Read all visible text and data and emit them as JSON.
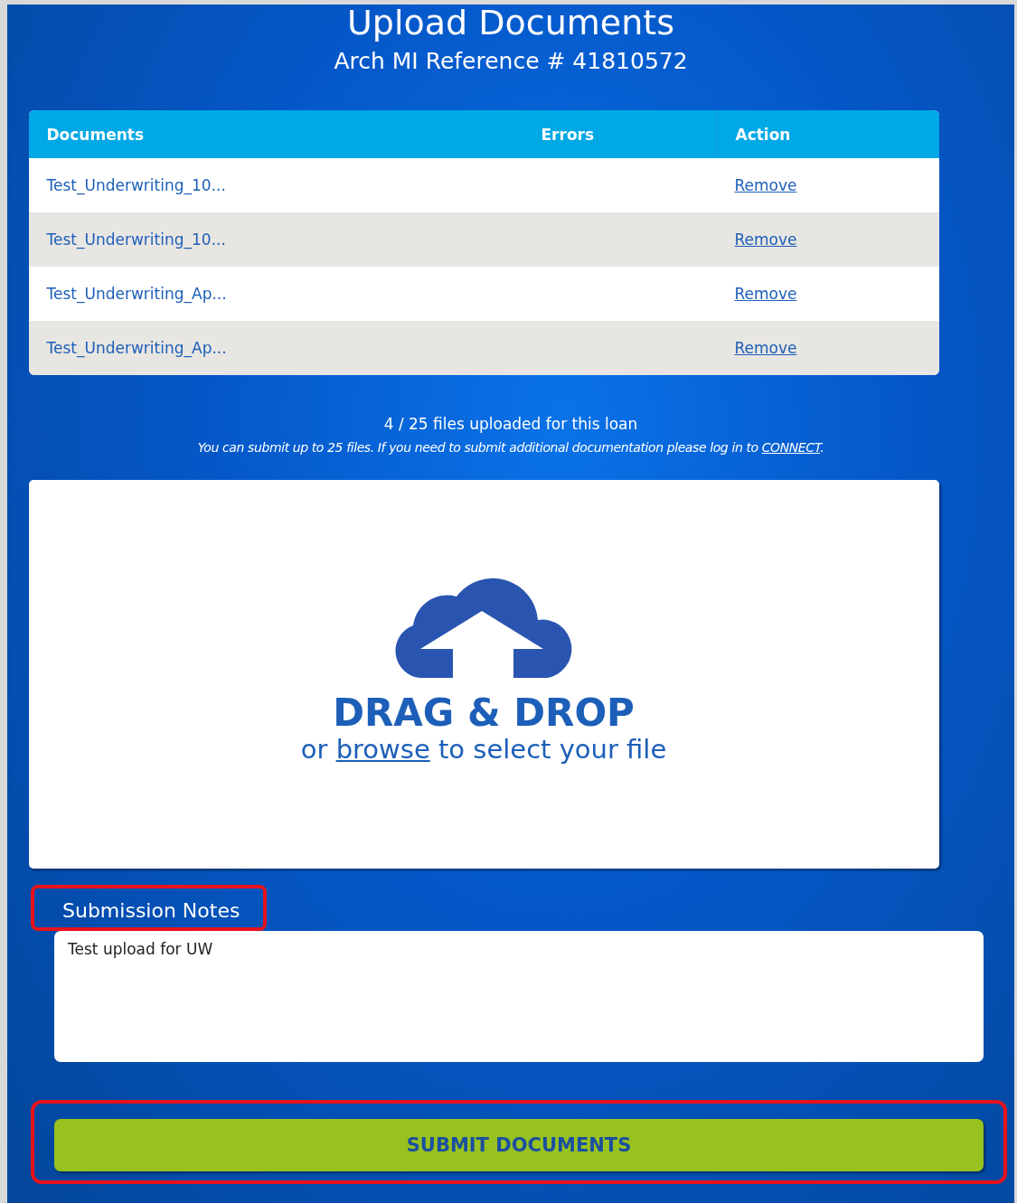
{
  "title": "Upload Documents",
  "reference": "Arch MI Reference # 41810572",
  "table": {
    "columns": [
      "Documents",
      "Errors",
      "Action"
    ],
    "rows": [
      {
        "document": "Test_Underwriting_10...",
        "action": "Remove"
      },
      {
        "document": "Test_Underwriting_10...",
        "action": "Remove"
      },
      {
        "document": "Test_Underwriting_Ap...",
        "action": "Remove"
      },
      {
        "document": "Test_Underwriting_Ap...",
        "action": "Remove"
      }
    ]
  },
  "file_count": "4 / 25 files uploaded for this loan",
  "note": {
    "text": "You can submit up to 25 files. If you need to submit additional documentation please log in to ",
    "link": "CONNECT",
    "after": "."
  },
  "dropzone": {
    "heading": "DRAG & DROP",
    "before": "or ",
    "link": "browse",
    "after": " to select your file"
  },
  "notes": {
    "label": "Submission Notes",
    "value": "Test upload for UW",
    "highlighted": true
  },
  "submit": {
    "label": "SUBMIT DOCUMENTS",
    "highlighted": true
  }
}
